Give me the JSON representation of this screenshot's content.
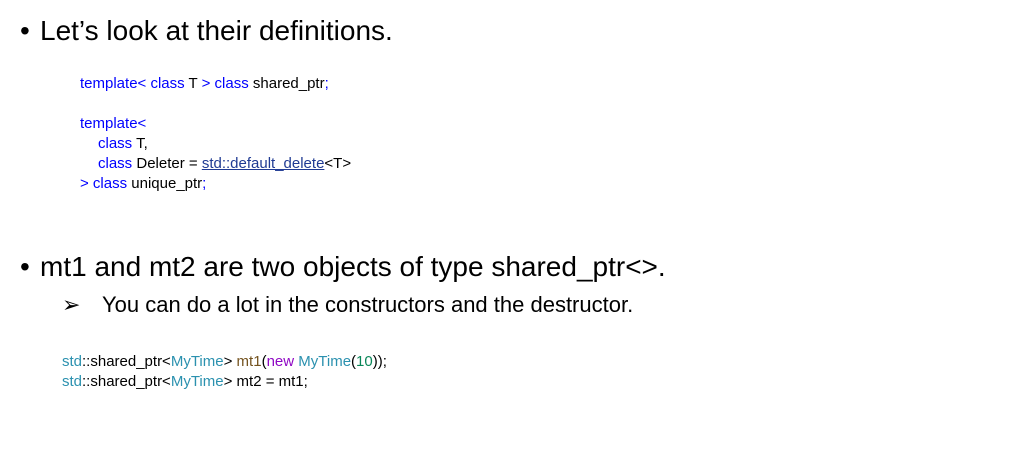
{
  "bullet1": {
    "text": "Let’s look at their definitions."
  },
  "code1": {
    "l1_template": "template<",
    "l1_class": " class",
    "l1_T": " T ",
    "l1_gt_class": "> class",
    "l1_name": " shared_ptr",
    "l1_semi": ";"
  },
  "code2": {
    "l1": "template<",
    "l2_kw": "class",
    "l2_rest": " T,",
    "l3_kw": "class",
    "l3_name": " Deleter = ",
    "l3_link": "std::default_delete",
    "l3_end": "<T>",
    "l4_kw": "> class",
    "l4_name": " unique_ptr",
    "l4_semi": ";"
  },
  "bullet2": {
    "text": "mt1 and mt2 are two objects of type shared_ptr<>."
  },
  "sub_bullet": {
    "text": "You can do a lot in the constructors and the destructor."
  },
  "code3": {
    "l1_std": "std",
    "l1_sp": "::shared_ptr<",
    "l1_type": "MyTime",
    "l1_gt": ">",
    "l1_var": " mt1",
    "l1_paren": "(",
    "l1_new": "new",
    "l1_sp2": " ",
    "l1_type2": "MyTime",
    "l1_p2": "(",
    "l1_num": "10",
    "l1_end": "));",
    "l2_std": "std",
    "l2_sp": "::shared_ptr<",
    "l2_type": "MyTime",
    "l2_rest": "> mt2 = mt1;"
  }
}
